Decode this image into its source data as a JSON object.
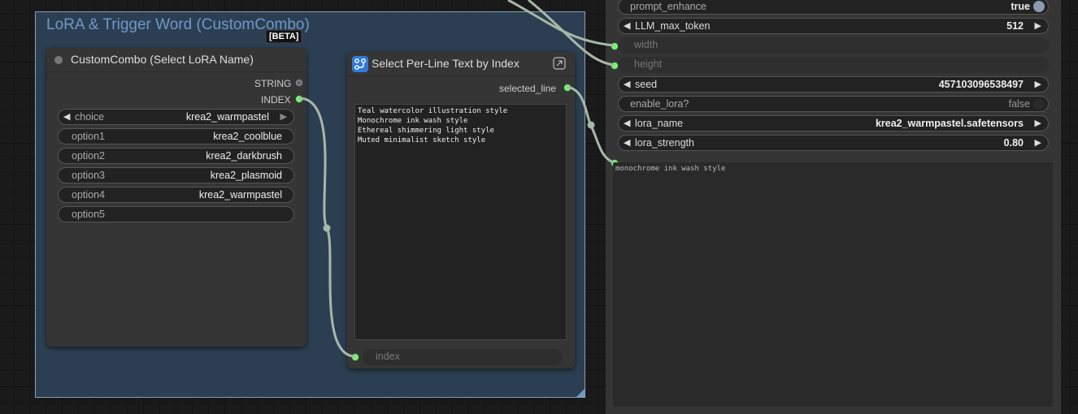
{
  "group": {
    "title": "LoRA & Trigger Word (CustomCombo)",
    "badge": "[BETA]"
  },
  "custom_combo": {
    "title": "CustomCombo (Select LoRA Name)",
    "outputs": [
      "STRING",
      "INDEX"
    ],
    "choice": {
      "label": "choice",
      "value": "krea2_warmpastel"
    },
    "options": [
      {
        "label": "option1",
        "value": "krea2_coolblue"
      },
      {
        "label": "option2",
        "value": "krea2_darkbrush"
      },
      {
        "label": "option3",
        "value": "krea2_plasmoid"
      },
      {
        "label": "option4",
        "value": "krea2_warmpastel"
      },
      {
        "label": "option5",
        "value": ""
      }
    ]
  },
  "select_line": {
    "title": "Select Per-Line Text by Index",
    "output": "selected_line",
    "text": "Teal watercolor illustration style\nMonochrome ink wash style\nEthereal shimmering light style\nMuted minimalist sketch style",
    "input": "index"
  },
  "right_panel": {
    "prompt_enhance": {
      "label": "prompt_enhance",
      "value": "true"
    },
    "llm_max_token": {
      "label": "LLM_max_token",
      "value": "512"
    },
    "width": {
      "label": "width"
    },
    "height": {
      "label": "height"
    },
    "seed": {
      "label": "seed",
      "value": "457103096538497"
    },
    "enable_lora": {
      "label": "enable_lora?",
      "value": "false"
    },
    "lora_name": {
      "label": "lora_name",
      "value": "krea2_warmpastel.safetensors"
    },
    "lora_strength": {
      "label": "lora_strength",
      "value": "0.80"
    },
    "preview_text": "monochrome ink wash style"
  },
  "colors": {
    "link": "#a8b8a8",
    "slot_active": "#7cf07c",
    "group_title": "#6f99c7",
    "group_bg": "#2c3f52"
  }
}
